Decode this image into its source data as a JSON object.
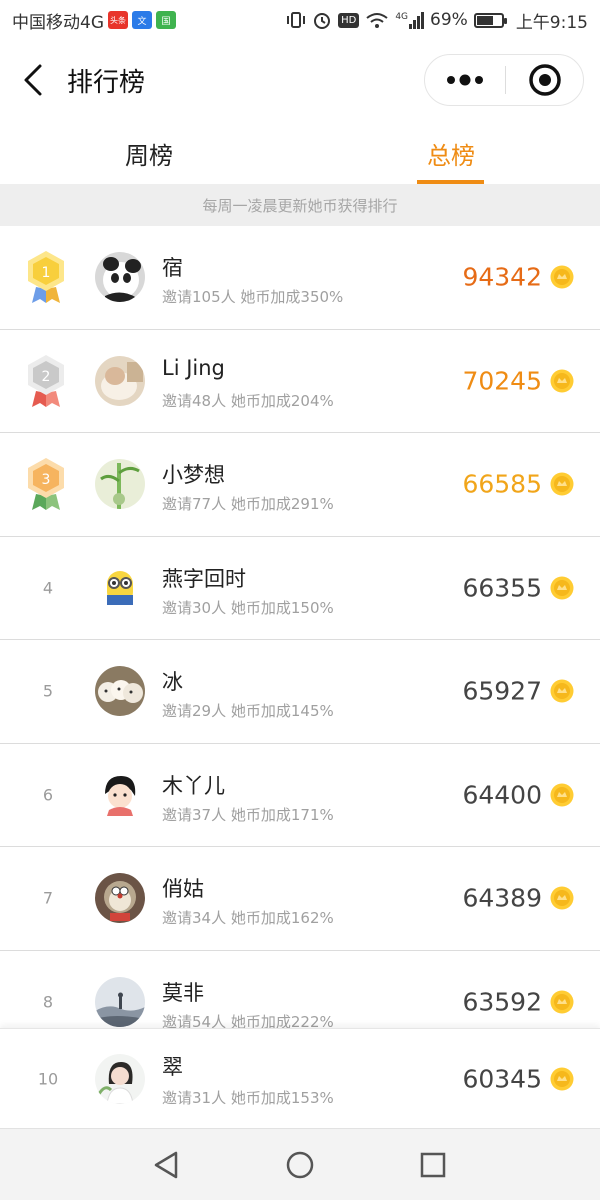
{
  "status_bar": {
    "carrier": "中国移动4G",
    "app_badge_1": "头条",
    "app_badge_2": "文",
    "app_badge_3": "国",
    "battery": "69%",
    "battery_level": 0.69,
    "network": "4G",
    "time": "上午9:15",
    "hd_label": "HD"
  },
  "navbar": {
    "title": "排行榜"
  },
  "tabs": [
    {
      "label": "周榜",
      "active": false
    },
    {
      "label": "总榜",
      "active": true
    }
  ],
  "notice": "每周一凌晨更新她币获得排行",
  "colors": {
    "accent": "#ef8c14",
    "rank1_score": "#e66b16",
    "rank2_score": "#ef8c14",
    "rank3_score": "#f1a51a",
    "normal_score": "#444444"
  },
  "ranking": [
    {
      "rank": "1",
      "medal": "gold",
      "name": "宿",
      "sub": "邀请105人 她币加成350%",
      "score": "94342"
    },
    {
      "rank": "2",
      "medal": "silver",
      "name": "Li Jing",
      "sub": "邀请48人 她币加成204%",
      "score": "70245"
    },
    {
      "rank": "3",
      "medal": "bronze",
      "name": "小梦想",
      "sub": "邀请77人 她币加成291%",
      "score": "66585"
    },
    {
      "rank": "4",
      "name": "燕字回时",
      "sub": "邀请30人 她币加成150%",
      "score": "66355"
    },
    {
      "rank": "5",
      "name": "冰",
      "sub": "邀请29人 她币加成145%",
      "score": "65927"
    },
    {
      "rank": "6",
      "name": "木丫儿",
      "sub": "邀请37人 她币加成171%",
      "score": "64400"
    },
    {
      "rank": "7",
      "name": "俏姑",
      "sub": "邀请34人 她币加成162%",
      "score": "64389"
    },
    {
      "rank": "8",
      "name": "莫非",
      "sub": "邀请54人 她币加成222%",
      "score": "63592"
    }
  ],
  "my_rank": {
    "rank": "10",
    "name": "翠",
    "sub": "邀请31人 她币加成153%",
    "score": "60345"
  },
  "icons": {
    "back": "back-arrow-icon",
    "more": "more-dots-icon",
    "close": "target-close-icon",
    "coin": "coin-icon",
    "nav_back": "triangle-back-icon",
    "nav_home": "circle-home-icon",
    "nav_recent": "square-recent-icon"
  }
}
